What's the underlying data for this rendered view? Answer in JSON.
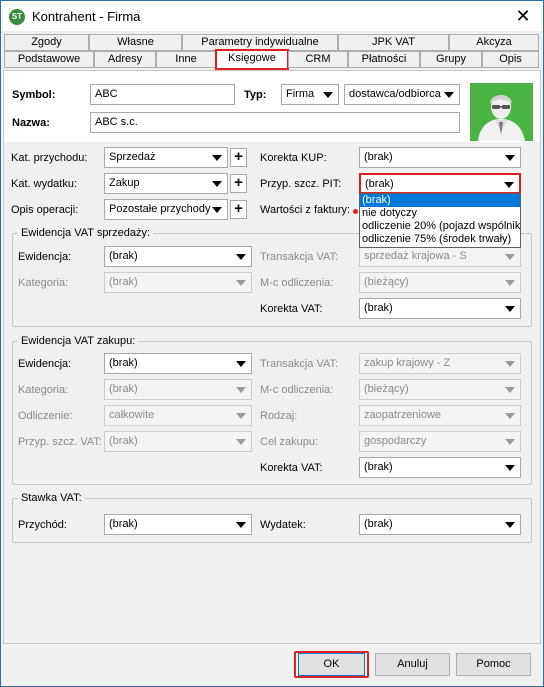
{
  "window": {
    "title": "Kontrahent - Firma",
    "icon_text": "ST"
  },
  "tabs_row1": [
    "Zgody",
    "Własne",
    "Parametry indywidualne",
    "JPK VAT",
    "Akcyza"
  ],
  "tabs_row2": [
    "Podstawowe",
    "Adresy",
    "Inne",
    "Księgowe",
    "CRM",
    "Płatności",
    "Grupy",
    "Opis"
  ],
  "header": {
    "symbol_label": "Symbol:",
    "symbol_value": "ABC",
    "typ_label": "Typ:",
    "typ_value": "Firma",
    "typ_role": "dostawca/odbiorca",
    "nazwa_label": "Nazwa:",
    "nazwa_value": "ABC s.c."
  },
  "top": {
    "kat_przychodu_label": "Kat. przychodu:",
    "kat_przychodu_value": "Sprzedaż",
    "kat_wydatku_label": "Kat. wydatku:",
    "kat_wydatku_value": "Zakup",
    "opis_label": "Opis operacji:",
    "opis_value": "Pozostałe przychody",
    "korekta_kup_label": "Korekta KUP:",
    "korekta_kup_value": "(brak)",
    "przyp_pit_label": "Przyp. szcz. PIT:",
    "przyp_pit_value": "(brak)",
    "wartosci_label": "Wartości z faktury:",
    "plus": "+"
  },
  "dropdown_options": [
    "(brak)",
    "nie dotyczy",
    "odliczenie 20% (pojazd wspólnika",
    "odliczenie 75% (środek trwały)"
  ],
  "sprzedaz": {
    "title": "Ewidencja VAT sprzedaży:",
    "ewidencja_label": "Ewidencja:",
    "ewidencja_value": "(brak)",
    "kategoria_label": "Kategoria:",
    "kategoria_value": "(brak)",
    "transakcja_label": "Transakcja VAT:",
    "transakcja_value": "sprzedaż krajowa - S",
    "mc_label": "M-c odliczenia:",
    "mc_value": "(bieżący)",
    "korekta_label": "Korekta VAT:",
    "korekta_value": "(brak)"
  },
  "zakup": {
    "title": "Ewidencja VAT zakupu:",
    "ewidencja_label": "Ewidencja:",
    "ewidencja_value": "(brak)",
    "kategoria_label": "Kategoria:",
    "kategoria_value": "(brak)",
    "odliczenie_label": "Odliczenie:",
    "odliczenie_value": "całkowite",
    "przyp_label": "Przyp. szcz. VAT:",
    "przyp_value": "(brak)",
    "transakcja_label": "Transakcja VAT:",
    "transakcja_value": "zakup krajowy - Z",
    "mc_label": "M-c odliczenia:",
    "mc_value": "(bieżący)",
    "rodzaj_label": "Rodzaj:",
    "rodzaj_value": "zaopatrzeniowe",
    "cel_label": "Cel zakupu:",
    "cel_value": "gospodarczy",
    "korekta_label": "Korekta VAT:",
    "korekta_value": "(brak)"
  },
  "stawka": {
    "title": "Stawka VAT:",
    "przychod_label": "Przychód:",
    "przychod_value": "(brak)",
    "wydatek_label": "Wydatek:",
    "wydatek_value": "(brak)"
  },
  "buttons": {
    "ok": "OK",
    "anuluj": "Anuluj",
    "pomoc": "Pomoc"
  },
  "colors": {
    "highlight": "#e02020",
    "selection": "#0078d7",
    "avatar_bg": "#4bb543"
  }
}
